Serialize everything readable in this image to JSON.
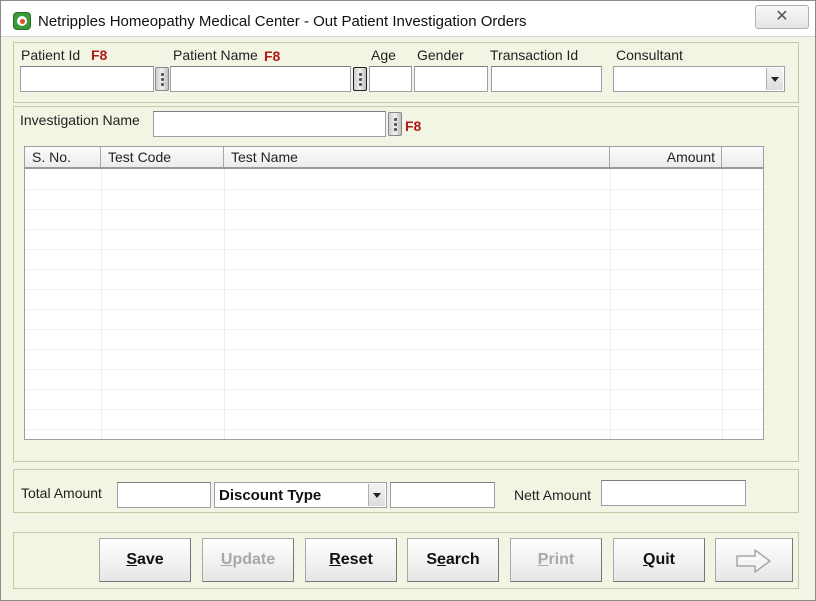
{
  "window": {
    "title": "Netripples Homeopathy Medical Center - Out Patient Investigation Orders",
    "close_symbol": "✕"
  },
  "patient": {
    "patient_id_label": "Patient Id",
    "patient_id_hotkey": "F8",
    "patient_id_value": "",
    "patient_name_label": "Patient Name",
    "patient_name_hotkey": "F8",
    "patient_name_value": "",
    "age_label": "Age",
    "age_value": "",
    "gender_label": "Gender",
    "gender_value": "",
    "transaction_id_label": "Transaction Id",
    "transaction_id_value": "",
    "consultant_label": "Consultant",
    "consultant_value": ""
  },
  "investigation": {
    "label": "Investigation Name",
    "hotkey": "F8",
    "value": ""
  },
  "grid": {
    "columns": [
      "S. No.",
      "Test Code",
      "Test Name",
      "Amount"
    ],
    "rows": []
  },
  "totals": {
    "total_amount_label": "Total Amount",
    "total_amount_value": "",
    "discount_type_selected": "Discount Type",
    "discount_value": "",
    "nett_amount_label": "Nett Amount",
    "nett_amount_value": ""
  },
  "actions": {
    "save_first": "S",
    "save_rest": "ave",
    "update_first": "U",
    "update_rest": "pdate",
    "reset_first": "R",
    "reset_rest": "eset",
    "search_pre": "S",
    "search_ul": "e",
    "search_rest": "arch",
    "print_first": "P",
    "print_rest": "rint",
    "quit_first": "Q",
    "quit_rest": "uit"
  },
  "icons": {
    "app": "app-logo-icon",
    "next": "arrow-right-icon"
  }
}
